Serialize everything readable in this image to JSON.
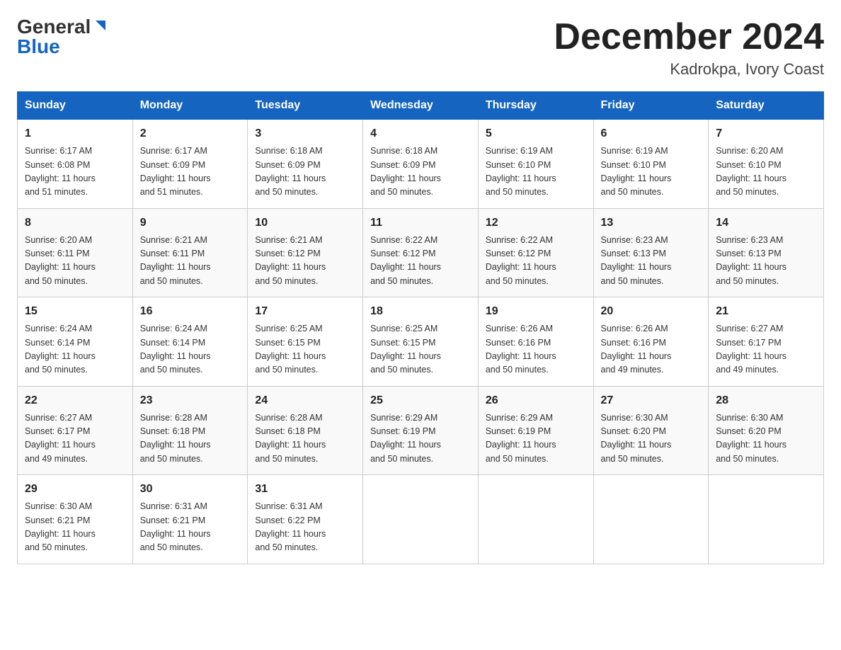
{
  "header": {
    "logo_general": "General",
    "logo_blue": "Blue",
    "main_title": "December 2024",
    "subtitle": "Kadrokpa, Ivory Coast"
  },
  "days_of_week": [
    "Sunday",
    "Monday",
    "Tuesday",
    "Wednesday",
    "Thursday",
    "Friday",
    "Saturday"
  ],
  "weeks": [
    [
      {
        "day": "1",
        "info": "Sunrise: 6:17 AM\nSunset: 6:08 PM\nDaylight: 11 hours\nand 51 minutes."
      },
      {
        "day": "2",
        "info": "Sunrise: 6:17 AM\nSunset: 6:09 PM\nDaylight: 11 hours\nand 51 minutes."
      },
      {
        "day": "3",
        "info": "Sunrise: 6:18 AM\nSunset: 6:09 PM\nDaylight: 11 hours\nand 50 minutes."
      },
      {
        "day": "4",
        "info": "Sunrise: 6:18 AM\nSunset: 6:09 PM\nDaylight: 11 hours\nand 50 minutes."
      },
      {
        "day": "5",
        "info": "Sunrise: 6:19 AM\nSunset: 6:10 PM\nDaylight: 11 hours\nand 50 minutes."
      },
      {
        "day": "6",
        "info": "Sunrise: 6:19 AM\nSunset: 6:10 PM\nDaylight: 11 hours\nand 50 minutes."
      },
      {
        "day": "7",
        "info": "Sunrise: 6:20 AM\nSunset: 6:10 PM\nDaylight: 11 hours\nand 50 minutes."
      }
    ],
    [
      {
        "day": "8",
        "info": "Sunrise: 6:20 AM\nSunset: 6:11 PM\nDaylight: 11 hours\nand 50 minutes."
      },
      {
        "day": "9",
        "info": "Sunrise: 6:21 AM\nSunset: 6:11 PM\nDaylight: 11 hours\nand 50 minutes."
      },
      {
        "day": "10",
        "info": "Sunrise: 6:21 AM\nSunset: 6:12 PM\nDaylight: 11 hours\nand 50 minutes."
      },
      {
        "day": "11",
        "info": "Sunrise: 6:22 AM\nSunset: 6:12 PM\nDaylight: 11 hours\nand 50 minutes."
      },
      {
        "day": "12",
        "info": "Sunrise: 6:22 AM\nSunset: 6:12 PM\nDaylight: 11 hours\nand 50 minutes."
      },
      {
        "day": "13",
        "info": "Sunrise: 6:23 AM\nSunset: 6:13 PM\nDaylight: 11 hours\nand 50 minutes."
      },
      {
        "day": "14",
        "info": "Sunrise: 6:23 AM\nSunset: 6:13 PM\nDaylight: 11 hours\nand 50 minutes."
      }
    ],
    [
      {
        "day": "15",
        "info": "Sunrise: 6:24 AM\nSunset: 6:14 PM\nDaylight: 11 hours\nand 50 minutes."
      },
      {
        "day": "16",
        "info": "Sunrise: 6:24 AM\nSunset: 6:14 PM\nDaylight: 11 hours\nand 50 minutes."
      },
      {
        "day": "17",
        "info": "Sunrise: 6:25 AM\nSunset: 6:15 PM\nDaylight: 11 hours\nand 50 minutes."
      },
      {
        "day": "18",
        "info": "Sunrise: 6:25 AM\nSunset: 6:15 PM\nDaylight: 11 hours\nand 50 minutes."
      },
      {
        "day": "19",
        "info": "Sunrise: 6:26 AM\nSunset: 6:16 PM\nDaylight: 11 hours\nand 50 minutes."
      },
      {
        "day": "20",
        "info": "Sunrise: 6:26 AM\nSunset: 6:16 PM\nDaylight: 11 hours\nand 49 minutes."
      },
      {
        "day": "21",
        "info": "Sunrise: 6:27 AM\nSunset: 6:17 PM\nDaylight: 11 hours\nand 49 minutes."
      }
    ],
    [
      {
        "day": "22",
        "info": "Sunrise: 6:27 AM\nSunset: 6:17 PM\nDaylight: 11 hours\nand 49 minutes."
      },
      {
        "day": "23",
        "info": "Sunrise: 6:28 AM\nSunset: 6:18 PM\nDaylight: 11 hours\nand 50 minutes."
      },
      {
        "day": "24",
        "info": "Sunrise: 6:28 AM\nSunset: 6:18 PM\nDaylight: 11 hours\nand 50 minutes."
      },
      {
        "day": "25",
        "info": "Sunrise: 6:29 AM\nSunset: 6:19 PM\nDaylight: 11 hours\nand 50 minutes."
      },
      {
        "day": "26",
        "info": "Sunrise: 6:29 AM\nSunset: 6:19 PM\nDaylight: 11 hours\nand 50 minutes."
      },
      {
        "day": "27",
        "info": "Sunrise: 6:30 AM\nSunset: 6:20 PM\nDaylight: 11 hours\nand 50 minutes."
      },
      {
        "day": "28",
        "info": "Sunrise: 6:30 AM\nSunset: 6:20 PM\nDaylight: 11 hours\nand 50 minutes."
      }
    ],
    [
      {
        "day": "29",
        "info": "Sunrise: 6:30 AM\nSunset: 6:21 PM\nDaylight: 11 hours\nand 50 minutes."
      },
      {
        "day": "30",
        "info": "Sunrise: 6:31 AM\nSunset: 6:21 PM\nDaylight: 11 hours\nand 50 minutes."
      },
      {
        "day": "31",
        "info": "Sunrise: 6:31 AM\nSunset: 6:22 PM\nDaylight: 11 hours\nand 50 minutes."
      },
      {
        "day": "",
        "info": ""
      },
      {
        "day": "",
        "info": ""
      },
      {
        "day": "",
        "info": ""
      },
      {
        "day": "",
        "info": ""
      }
    ]
  ]
}
